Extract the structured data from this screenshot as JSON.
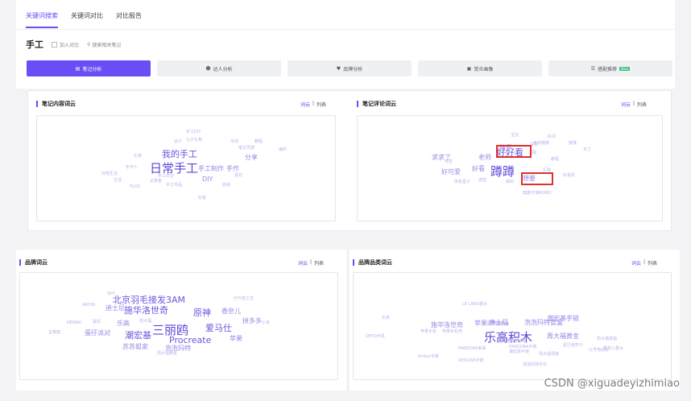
{
  "tabs": [
    "关键词搜索",
    "关键词对比",
    "对比报告"
  ],
  "keyword": {
    "title": "手工",
    "compare_label": "加入对比",
    "search_label": "搜索相关笔记"
  },
  "buttons": [
    {
      "label": "笔记分析",
      "icon": "doc-icon"
    },
    {
      "label": "达人分析",
      "icon": "user-icon"
    },
    {
      "label": "品牌分析",
      "icon": "heart-icon"
    },
    {
      "label": "受众画像",
      "icon": "person-card-icon"
    },
    {
      "label": "搭配推荐",
      "icon": "list-icon",
      "badge": "Beta"
    }
  ],
  "toggle": {
    "cloud": "词云",
    "list": "列表"
  },
  "panels": {
    "note_content": {
      "title": "笔记内容词云",
      "words": [
        {
          "w": "日常手工",
          "s": "xl"
        },
        {
          "w": "我的手工",
          "s": "l"
        },
        {
          "w": "手工制作",
          "s": "m"
        },
        {
          "w": "DIY",
          "s": "m"
        },
        {
          "w": "手作",
          "s": "m"
        },
        {
          "w": "分享",
          "s": "m"
        },
        {
          "w": "手工日记",
          "s": "s"
        },
        {
          "w": "记录者",
          "s": "s"
        },
        {
          "w": "手工DIY",
          "s": "s"
        },
        {
          "w": "七夕礼物",
          "s": "s"
        },
        {
          "w": "笔记灵感",
          "s": "s"
        },
        {
          "w": "编织",
          "s": "s"
        },
        {
          "w": "手工作品",
          "s": "s"
        },
        {
          "w": "设计",
          "s": "s"
        },
        {
          "w": "毛线",
          "s": "s"
        },
        {
          "w": "PLOG",
          "s": "s"
        },
        {
          "w": "喜欢",
          "s": "s"
        },
        {
          "w": "教程",
          "s": "s"
        },
        {
          "w": "日常生活",
          "s": "s"
        },
        {
          "w": "手作人",
          "s": "s"
        },
        {
          "w": "收纳",
          "s": "s"
        },
        {
          "w": "礼物",
          "s": "s"
        },
        {
          "w": "好看",
          "s": "s"
        },
        {
          "w": "生活",
          "s": "s"
        }
      ]
    },
    "note_comment": {
      "title": "笔记评论词云",
      "words": [
        {
          "w": "蹲蹲",
          "s": "xl"
        },
        {
          "w": "好好看",
          "s": "l"
        },
        {
          "w": "想要",
          "s": "m"
        },
        {
          "w": "求求了",
          "s": "m"
        },
        {
          "w": "老师",
          "s": "m"
        },
        {
          "w": "好看",
          "s": "m"
        },
        {
          "w": "好可爱",
          "s": "m"
        },
        {
          "w": "孩子",
          "s": "m"
        },
        {
          "w": "求图",
          "s": "s"
        },
        {
          "w": "可爱",
          "s": "s"
        },
        {
          "w": "感觉",
          "s": "s"
        },
        {
          "w": "做的",
          "s": "s"
        },
        {
          "w": "喜欢",
          "s": "s"
        },
        {
          "w": "宝宝",
          "s": "s"
        },
        {
          "w": "教程",
          "s": "s"
        },
        {
          "w": "MOMO",
          "s": "s"
        },
        {
          "w": "健康平安",
          "s": "s"
        },
        {
          "w": "好喜欢",
          "s": "s"
        },
        {
          "w": "礼物",
          "s": "s"
        },
        {
          "w": "惊喜盒子",
          "s": "s"
        },
        {
          "w": "身体健康",
          "s": "s"
        },
        {
          "w": "链接",
          "s": "s"
        },
        {
          "w": "好评",
          "s": "s"
        },
        {
          "w": "买了",
          "s": "s"
        }
      ]
    },
    "brand": {
      "title": "品牌词云",
      "words": [
        {
          "w": "三丽鸥",
          "s": "xl"
        },
        {
          "w": "施华洛世奇",
          "s": "l"
        },
        {
          "w": "北京羽毛接发3AM",
          "s": "l"
        },
        {
          "w": "Procreate",
          "s": "l"
        },
        {
          "w": "爱马仕",
          "s": "l"
        },
        {
          "w": "潮宏基",
          "s": "l"
        },
        {
          "w": "原神",
          "s": "l"
        },
        {
          "w": "香奈儿",
          "s": "m"
        },
        {
          "w": "迪士尼",
          "s": "m"
        },
        {
          "w": "苏苏姐家",
          "s": "m"
        },
        {
          "w": "乐高",
          "s": "m"
        },
        {
          "w": "泡泡玛特",
          "s": "m"
        },
        {
          "w": "苹果",
          "s": "m"
        },
        {
          "w": "拼多多",
          "s": "m"
        },
        {
          "w": "周大福",
          "s": "s"
        },
        {
          "w": "蛋仔派对",
          "s": "m"
        },
        {
          "w": "AKOYA",
          "s": "s"
        },
        {
          "w": "NEIWAI",
          "s": "s"
        },
        {
          "w": "SKP",
          "s": "s"
        },
        {
          "w": "猛玛",
          "s": "s"
        },
        {
          "w": "光与夜之恋",
          "s": "s"
        },
        {
          "w": "宝格丽",
          "s": "s"
        },
        {
          "w": "周大福黄金",
          "s": "s"
        },
        {
          "w": "小米",
          "s": "s"
        }
      ]
    },
    "brand_category": {
      "title": "品牌品类词云",
      "words": [
        {
          "w": "乐高积木",
          "s": "xl"
        },
        {
          "w": "施华洛世奇",
          "s": "m"
        },
        {
          "w": "苹果iPhone",
          "s": "m"
        },
        {
          "w": "泡泡玛特盲盒",
          "s": "m"
        },
        {
          "w": "周大福黄金",
          "s": "m"
        },
        {
          "w": "迪士尼",
          "s": "m"
        },
        {
          "w": "潮宏基手链",
          "s": "m"
        },
        {
          "w": "苹果手机壳",
          "s": "s"
        },
        {
          "w": "苹果手机",
          "s": "s"
        },
        {
          "w": "PANDORA手链",
          "s": "s"
        },
        {
          "w": "PANDORA串珠",
          "s": "s"
        },
        {
          "w": "周大福项链",
          "s": "s"
        },
        {
          "w": "潮宏基手链",
          "s": "s"
        },
        {
          "w": "施华洛世奇项链",
          "s": "s"
        },
        {
          "w": "LE LABO香水",
          "s": "s"
        },
        {
          "w": "OPPO手机",
          "s": "s"
        },
        {
          "w": "Kinbor手帐",
          "s": "s"
        },
        {
          "w": "泡泡玛特手办",
          "s": "s"
        },
        {
          "w": "REDLINE手链",
          "s": "s"
        },
        {
          "w": "乐高",
          "s": "s"
        },
        {
          "w": "九号电动车",
          "s": "s"
        },
        {
          "w": "周大福戒指",
          "s": "s"
        },
        {
          "w": "星巴克杯子",
          "s": "s"
        },
        {
          "w": "香奈儿香水",
          "s": "s"
        }
      ]
    }
  },
  "watermark": "CSDN @xiguadeyizhimiao"
}
